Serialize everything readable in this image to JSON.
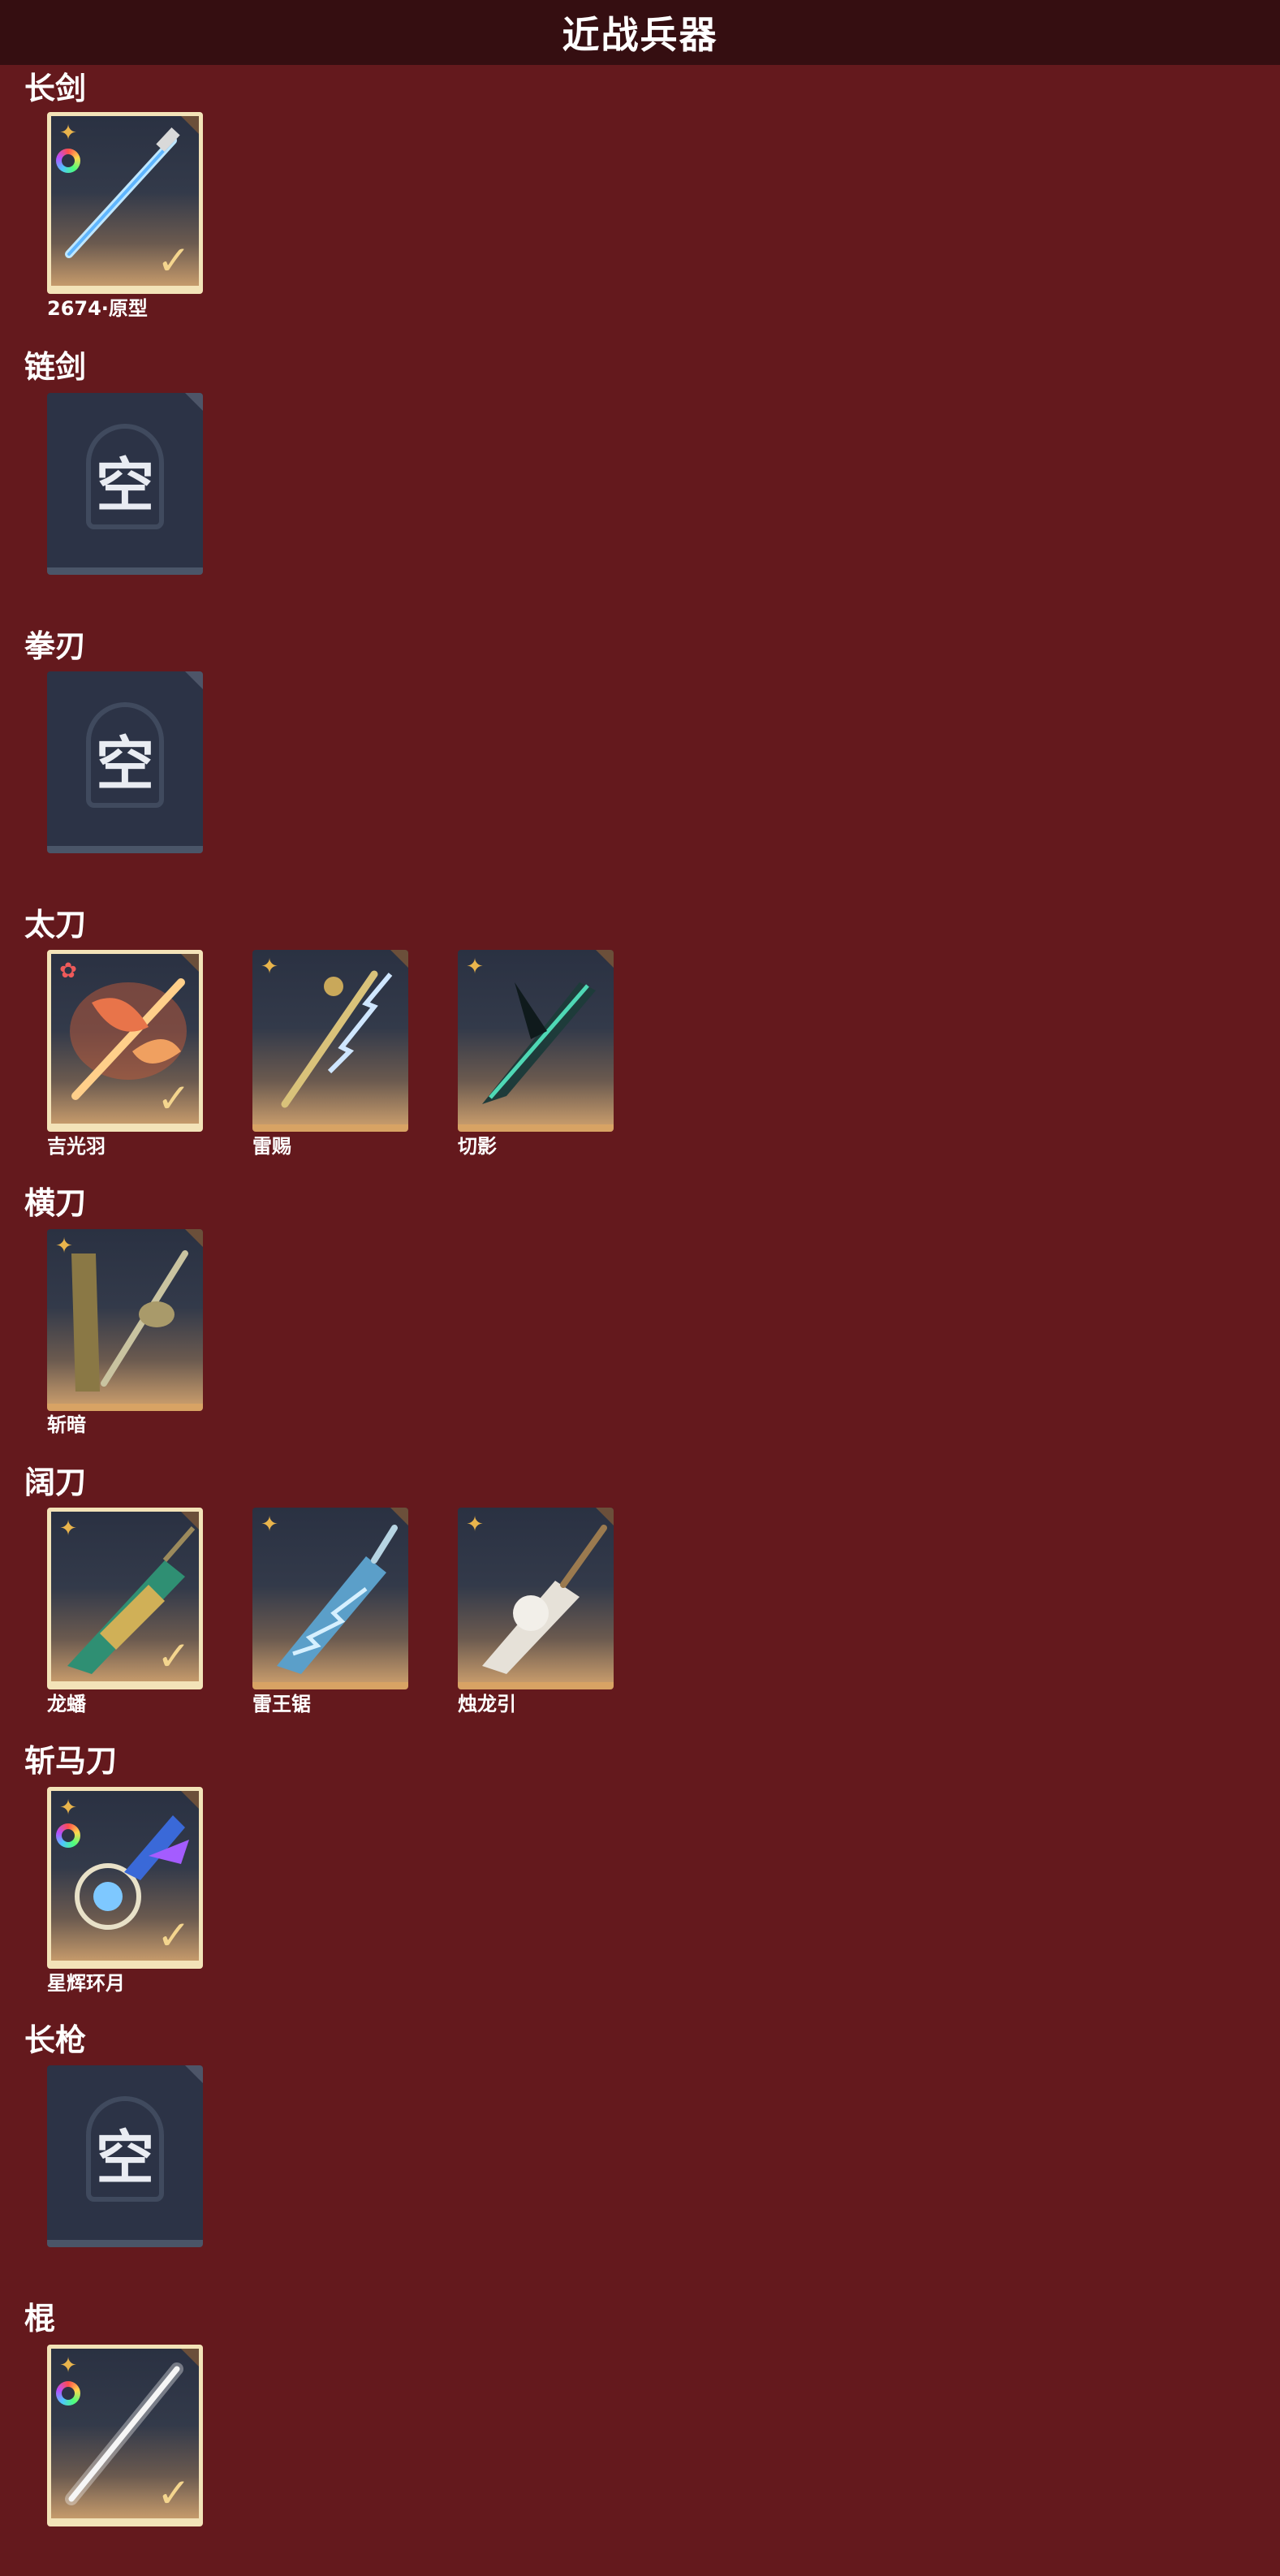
{
  "page_title": "近战兵器",
  "empty_label": "空",
  "categories": [
    {
      "name": "长剑",
      "weapons": [
        {
          "name": "2674·原型",
          "equipped": true,
          "badge": "gold",
          "ring": true
        }
      ]
    },
    {
      "name": "链剑",
      "weapons": []
    },
    {
      "name": "拳刃",
      "weapons": []
    },
    {
      "name": "太刀",
      "weapons": [
        {
          "name": "吉光羽",
          "equipped": true,
          "badge": "red"
        },
        {
          "name": "雷赐",
          "equipped": false,
          "badge": "gold"
        },
        {
          "name": "切影",
          "equipped": false,
          "badge": "gold"
        }
      ]
    },
    {
      "name": "横刀",
      "weapons": [
        {
          "name": "斩暗",
          "equipped": false,
          "badge": "gold"
        }
      ]
    },
    {
      "name": "阔刀",
      "weapons": [
        {
          "name": "龙蟠",
          "equipped": true,
          "badge": "gold"
        },
        {
          "name": "雷王锯",
          "equipped": false,
          "badge": "gold"
        },
        {
          "name": "烛龙引",
          "equipped": false,
          "badge": "gold"
        }
      ]
    },
    {
      "name": "斩马刀",
      "weapons": [
        {
          "name": "星辉环月",
          "equipped": true,
          "badge": "gold",
          "ring": true
        }
      ]
    },
    {
      "name": "长枪",
      "weapons": []
    },
    {
      "name": "棍",
      "weapons": [
        {
          "name": "",
          "equipped": true,
          "badge": "gold",
          "ring": true
        }
      ]
    }
  ],
  "colors": {
    "background": "#64191d",
    "header": "#350e11",
    "equipped_border": "#f3e3b8",
    "gold_bar": "#d8a364",
    "empty_tile": "#2c3346"
  },
  "icons": {
    "badge": "four-point-star-icon",
    "equipped": "checkmark-icon",
    "ring": "rainbow-ring-icon"
  }
}
